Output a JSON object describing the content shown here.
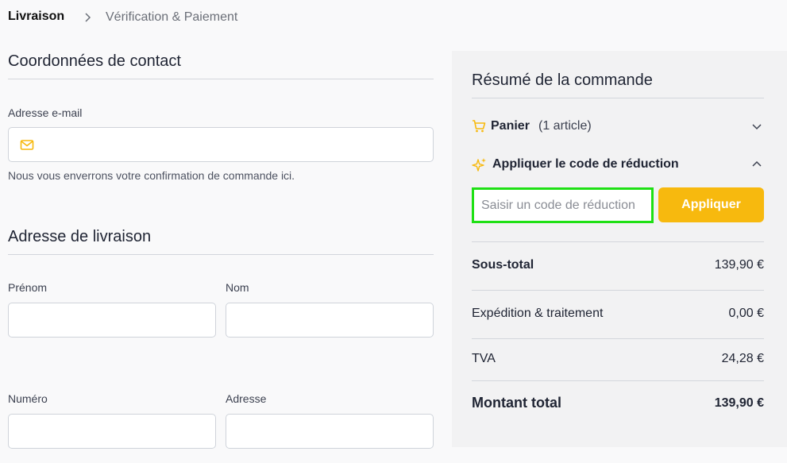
{
  "breadcrumb": {
    "current": "Livraison",
    "next": "Vérification & Paiement"
  },
  "contact": {
    "title": "Coordonnées de contact",
    "email_label": "Adresse e-mail",
    "email_hint": "Nous vous enverrons votre confirmation de commande ici."
  },
  "shipping": {
    "title": "Adresse de livraison",
    "first_name_label": "Prénom",
    "last_name_label": "Nom",
    "number_label": "Numéro",
    "address_label": "Adresse"
  },
  "summary": {
    "title": "Résumé de la commande",
    "cart_label": "Panier",
    "cart_count": "(1 article)",
    "discount_label": "Appliquer le code de réduction",
    "discount_placeholder": "Saisir un code de réduction",
    "apply_label": "Appliquer",
    "subtotal_label": "Sous-total",
    "subtotal_value": "139,90 €",
    "shipping_label": "Expédition & traitement",
    "shipping_value": "0,00 €",
    "tax_label": "TVA",
    "tax_value": "24,28 €",
    "total_label": "Montant total",
    "total_value": "139,90 €"
  },
  "colors": {
    "accent": "#f7b90e",
    "focus_border": "#1ee014"
  },
  "icons": [
    "chevron-right-icon",
    "mail-icon",
    "cart-icon",
    "sparkles-icon",
    "chevron-down-icon",
    "chevron-up-icon"
  ]
}
